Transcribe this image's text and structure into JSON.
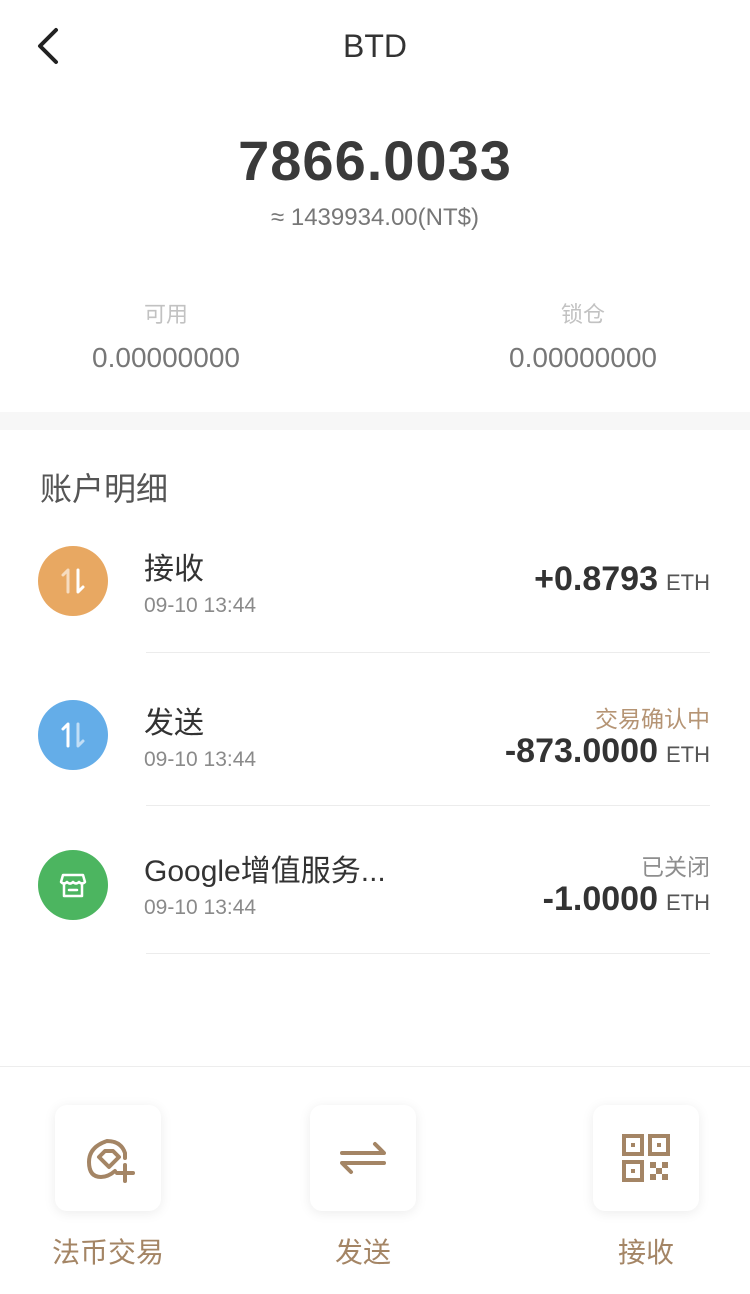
{
  "nav": {
    "title": "BTD"
  },
  "balance": {
    "total": "7866.0033",
    "fiat": "≈ 1439934.00(NT$)",
    "available_label": "可用",
    "available_value": "0.00000000",
    "locked_label": "锁仓",
    "locked_value": "0.00000000"
  },
  "details": {
    "title": "账户明细",
    "transactions": [
      {
        "name": "接收",
        "time": "09-10 13:44",
        "status": "",
        "amount": "+0.8793",
        "unit": "ETH",
        "icon": "receive-icon",
        "icon_color": "#e8a862"
      },
      {
        "name": "发送",
        "time": "09-10 13:44",
        "status": "交易确认中",
        "status_color": "#b59474",
        "amount": "-873.0000",
        "unit": "ETH",
        "icon": "send-icon",
        "icon_color": "#64ade8"
      },
      {
        "name": "Google增值服务...",
        "time": "09-10 13:44",
        "status": "已关闭",
        "status_color": "#8e8e8e",
        "amount": "-1.0000",
        "unit": "ETH",
        "icon": "store-icon",
        "icon_color": "#4cb560"
      }
    ]
  },
  "actions": [
    {
      "label": "法币交易",
      "icon": "fiat-trade-icon"
    },
    {
      "label": "发送",
      "icon": "transfer-icon"
    },
    {
      "label": "接收",
      "icon": "qr-code-icon"
    }
  ],
  "colors": {
    "accent": "#a48565",
    "background": "#f7f7f7"
  }
}
